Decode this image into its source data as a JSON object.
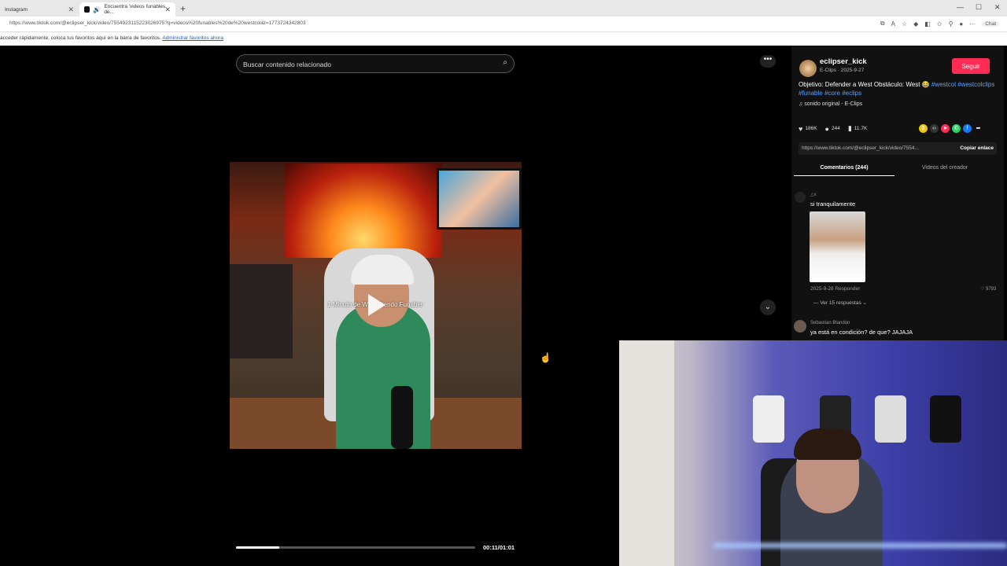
{
  "browser": {
    "tabs": [
      {
        "label": "Instagram"
      },
      {
        "label": "Encuentra 'videos funables de..."
      }
    ],
    "url": "https://www.tiktok.com/@eclipser_kick/video/7554923115223026975?q=videos%20funables%20de%20westcol&t=1773724342803",
    "favorites_bar_text": "acceder rápidamente, coloca tus favoritos aquí en la barra de favoritos.",
    "favorites_bar_link": "Administrar favoritos ahora",
    "chat_label": "Chat"
  },
  "search": {
    "placeholder": "Buscar contenido relacionado"
  },
  "player": {
    "overlay_title": "1 Minuto de West Siendo Funable:",
    "time": "00:11/01:01",
    "progress": 0.18
  },
  "author": {
    "name": "eclipser_kick",
    "subtitle": "E-Clips · 2025-9-27",
    "follow_label": "Seguir"
  },
  "description": {
    "text": "Objetivo: Defender a West Obstáculo: West 😂",
    "tags": [
      "#westcol",
      "#westcolclips",
      "#funable",
      "#core",
      "#eclips"
    ]
  },
  "music": {
    "label": "sonido original - E-Clips"
  },
  "stats": {
    "likes": "186K",
    "comments": "244",
    "saves": "11.7K"
  },
  "share": {
    "link": "https://www.tiktok.com/@eclipser_kick/video/7554...",
    "copy_label": "Copiar enlace"
  },
  "tabs": {
    "comments": "Comentarios (244)",
    "creator_videos": "Videos del creador"
  },
  "comments": [
    {
      "user": "△x",
      "text": "si tranquilamente",
      "meta": "2025-9-28   Responder",
      "likes": "9793",
      "replies": "Ver 15 respuestas"
    },
    {
      "user": "Sebastian Blandon",
      "text": "ya está en condición? de que? JAJAJA"
    }
  ],
  "colors": {
    "follow": "#fe2c55",
    "hashtag": "#5aa0ff",
    "background": "#000000"
  }
}
